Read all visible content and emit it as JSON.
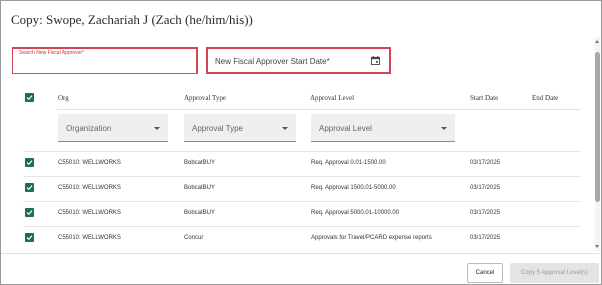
{
  "dialog": {
    "title": "Copy: Swope, Zachariah J (Zach (he/him/his))"
  },
  "fields": {
    "approver_placeholder": "Search New Fiscal Approver*",
    "start_date_placeholder": "New Fiscal Approver Start Date*"
  },
  "table": {
    "headers": {
      "org": "Org",
      "approval_type": "Approval Type",
      "approval_level": "Approval Level",
      "start_date": "Start Date",
      "end_date": "End Date"
    },
    "filters": {
      "organization": "Organization",
      "approval_type": "Approval Type",
      "approval_level": "Approval Level"
    },
    "rows": [
      {
        "org": "C55010: WELLWORKS",
        "type": "BobcatBUY",
        "level": "Req. Approval 0.01-1500.00",
        "start": "03/17/2025",
        "checked": true
      },
      {
        "org": "C55010: WELLWORKS",
        "type": "BobcatBUY",
        "level": "Req. Approval 1500.01-5000.00",
        "start": "03/17/2025",
        "checked": true
      },
      {
        "org": "C55010: WELLWORKS",
        "type": "BobcatBUY",
        "level": "Req. Approval 5000.01-10000.00",
        "start": "03/17/2025",
        "checked": true
      },
      {
        "org": "C55010: WELLWORKS",
        "type": "Concur",
        "level": "Approvals for Travel/PCARD expense reports",
        "start": "03/17/2025",
        "checked": true
      }
    ]
  },
  "footer": {
    "cancel_label": "Cancel",
    "copy_label": "Copy 5 Approval Level(s)"
  },
  "colors": {
    "checkbox": "#1e6e55",
    "error_border": "#d04457"
  }
}
